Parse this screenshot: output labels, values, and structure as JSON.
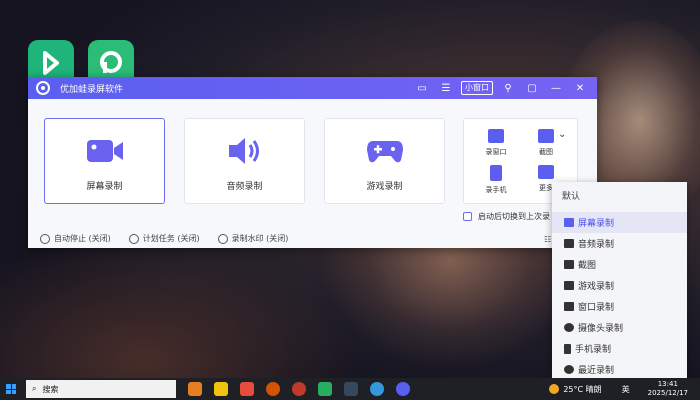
{
  "window": {
    "title": "优加蛙录屏软件",
    "mini_window_label": "小窗口",
    "cards": [
      {
        "label": "屏幕录制"
      },
      {
        "label": "音频录制"
      },
      {
        "label": "游戏录制"
      }
    ],
    "small_items": [
      "录窗口",
      "截图",
      "录手机",
      "更多"
    ],
    "auto_switch_label": "启动后切换到上次录",
    "footer": [
      {
        "label": "自动停止 (关闭)"
      },
      {
        "label": "计划任务 (关闭)"
      },
      {
        "label": "录制水印 (关闭)"
      }
    ],
    "accent_color": "#5a5ff0"
  },
  "menu": {
    "header": "默认",
    "items": [
      "屏幕录制",
      "音频录制",
      "截图",
      "游戏录制",
      "窗口录制",
      "摄像头录制",
      "手机录制",
      "最近录制"
    ],
    "active_index": 0
  },
  "taskbar": {
    "search_placeholder": "搜索",
    "weather": "25°C 晴朗",
    "ime": "英",
    "time": "13:41",
    "date": "2025/12/17"
  }
}
